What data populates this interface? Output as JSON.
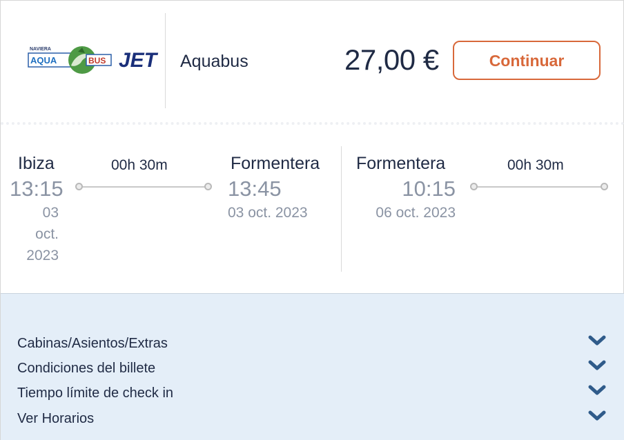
{
  "header": {
    "logo_text": {
      "top": "NAVIERA",
      "aqua": "AQUA",
      "bus": "BUS",
      "jet": "JET"
    },
    "operator": "Aquabus",
    "price": "27,00 €",
    "continue_label": "Continuar"
  },
  "outbound": {
    "origin_city": "Ibiza",
    "origin_time": "13:15",
    "origin_date_lines": [
      "03",
      "oct.",
      "2023"
    ],
    "duration": "00h 30m",
    "dest_city": "Formentera",
    "dest_time": "13:45",
    "dest_date": "03 oct. 2023"
  },
  "return": {
    "origin_city": "Formentera",
    "origin_time": "10:15",
    "origin_date": "06 oct. 2023",
    "duration": "00h 30m"
  },
  "options": [
    {
      "label": "Cabinas/Asientos/Extras",
      "icon": "chevron-down-icon"
    },
    {
      "label": "Condiciones del billete",
      "icon": "chevron-down-icon"
    },
    {
      "label": "Tiempo límite de check in",
      "icon": "chevron-down-icon"
    },
    {
      "label": "Ver Horarios",
      "icon": "chevron-down-icon"
    }
  ],
  "colors": {
    "accent": "#d8683a",
    "text": "#1f2a44",
    "muted": "#8a93a3",
    "panel": "#e4eef8",
    "chevron": "#2f5b8a"
  }
}
